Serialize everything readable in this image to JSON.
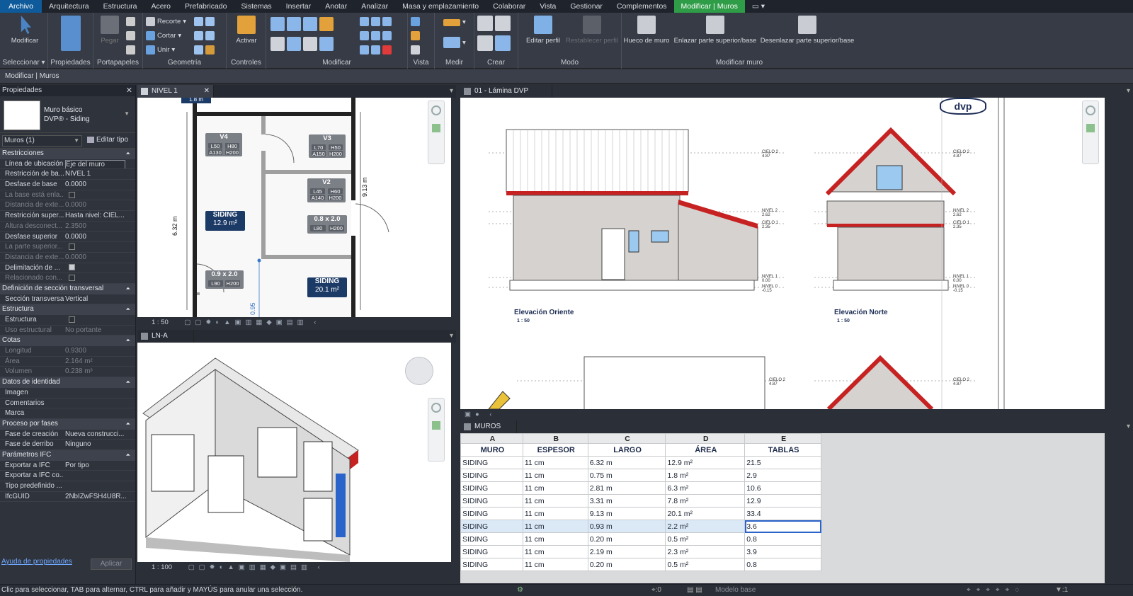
{
  "menu": {
    "items": [
      "Archivo",
      "Arquitectura",
      "Estructura",
      "Acero",
      "Prefabricado",
      "Sistemas",
      "Insertar",
      "Anotar",
      "Analizar",
      "Masa y emplazamiento",
      "Colaborar",
      "Vista",
      "Gestionar",
      "Complementos",
      "Modificar | Muros",
      "▭ ▾"
    ]
  },
  "ribbon": {
    "modify_label": "Modificar",
    "properties_label": "Propiedades",
    "paste_label": "Pegar",
    "cut_label": "Recorte",
    "cortar_label": "Cortar",
    "join_label": "Unir",
    "activate_label": "Activar",
    "edit_profile_label": "Editar perfil",
    "reset_profile_label": "Restablecer perfil",
    "wall_opening_label": "Hueco de muro",
    "attach_label": "Enlazar parte superior/base",
    "detach_label": "Desenlazar parte superior/base",
    "groups": [
      "Seleccionar ▾",
      "Propiedades",
      "Portapapeles",
      "Geometría",
      "Controles",
      "Modificar",
      "Vista",
      "Medir",
      "Crear",
      "Modo",
      "Modificar muro"
    ]
  },
  "context": {
    "title": "Modificar | Muros"
  },
  "properties": {
    "title": "Propiedades",
    "type_family": "Muro básico",
    "type_name": "DVP® - Siding",
    "selection": "Muros (1)",
    "edit_type": "Editar tipo",
    "sections": {
      "restricciones": "Restricciones",
      "seccion": "Definición de sección transversal",
      "estructura": "Estructura",
      "cotas": "Cotas",
      "identidad": "Datos de identidad",
      "fases": "Proceso por fases",
      "ifc": "Parámetros IFC"
    },
    "rows": {
      "r1k": "Línea de ubicación",
      "r1v": "Eje del muro",
      "r2k": "Restricción de ba...",
      "r2v": "NIVEL 1",
      "r3k": "Desfase de base",
      "r3v": "0.0000",
      "r4k": "La base está enla...",
      "r5k": "Distancia de exte...",
      "r5v": "0.0000",
      "r6k": "Restricción super...",
      "r6v": "Hasta nivel: CIEL...",
      "r7k": "Altura desconect...",
      "r7v": "2.3500",
      "r8k": "Desfase superior",
      "r8v": "0.0000",
      "r9k": "La parte superior...",
      "r10k": "Distancia de exte...",
      "r10v": "0.0000",
      "r11k": "Delimitación de ...",
      "r12k": "Relacionado con...",
      "s1k": "Sección transversal",
      "s1v": "Vertical",
      "e1k": "Estructura",
      "e2k": "Uso estructural",
      "e2v": "No portante",
      "c1k": "Longitud",
      "c1v": "0.9300",
      "c2k": "Área",
      "c2v": "2.164 m²",
      "c3k": "Volumen",
      "c3v": "0.238 m³",
      "i1k": "Imagen",
      "i2k": "Comentarios",
      "i3k": "Marca",
      "f1k": "Fase de creación",
      "f1v": "Nueva construcci...",
      "f2k": "Fase de derribo",
      "f2v": "Ninguno",
      "p1k": "Exportar a IFC",
      "p1v": "Por tipo",
      "p2k": "Exportar a IFC co...",
      "p3k": "Tipo predefinido ...",
      "p4k": "IfcGUID",
      "p4v": "2NbIZwFSH4U8R..."
    },
    "help": "Ayuda de propiedades",
    "apply": "Aplicar"
  },
  "plan": {
    "tab": "NIVEL 1",
    "scale": "1 : 50",
    "dim_top": "1.8 m",
    "dim_left": "6.32 m",
    "dim_right": "9.13 m",
    "dim_bottom": "0.95",
    "v4": "V4",
    "v4a": "L50",
    "v4b": "H80",
    "v4c": "A130",
    "v4d": "H200",
    "v3": "V3",
    "v3a": "L70",
    "v3b": "H50",
    "v3c": "A150",
    "v3d": "H200",
    "v2": "V2",
    "v2a": "L45",
    "v2b": "H60",
    "v2c": "A140",
    "v2d": "H200",
    "p1": "0.8 x 2.0",
    "p1a": "L80",
    "p1b": "H200",
    "p2": "0.9 x 2.0",
    "p2a": "L90",
    "p2b": "H200",
    "s1": "SIDING",
    "s1v": "12.9 m²",
    "s2": "SIDING",
    "s2v": "20.1 m²"
  },
  "iso": {
    "tab": "LN-A",
    "scale": "1 : 100"
  },
  "sheet": {
    "tab": "01 - Lámina DVP",
    "logo": "dvp",
    "elev1": "Elevación Oriente",
    "elev1s": "1 : 50",
    "elev2": "Elevación Norte",
    "elev2s": "1 : 50",
    "lv_cielo2": "CIELO 2",
    "lv_cielo2v": "4.87",
    "lv_nivel2": "NIVEL 2",
    "lv_nivel2v": "2.62",
    "lv_cielo1": "CIELO 1",
    "lv_cielo1v": "2.35",
    "lv_nivel1": "NIVEL 1",
    "lv_nivel1v": "0.00",
    "lv_nivel0": "NIVEL 0",
    "lv_nivel0v": "-0.15"
  },
  "schedule": {
    "tab": "MUROS",
    "letters": [
      "A",
      "B",
      "C",
      "D",
      "E"
    ],
    "headers": [
      "MURO",
      "ESPESOR",
      "LARGO",
      "ÁREA",
      "TABLAS"
    ],
    "rows": [
      [
        "SIDING",
        "11 cm",
        "6.32 m",
        "12.9 m²",
        "21.5"
      ],
      [
        "SIDING",
        "11 cm",
        "0.75 m",
        "1.8 m²",
        "2.9"
      ],
      [
        "SIDING",
        "11 cm",
        "2.81 m",
        "6.3 m²",
        "10.6"
      ],
      [
        "SIDING",
        "11 cm",
        "3.31 m",
        "7.8 m²",
        "12.9"
      ],
      [
        "SIDING",
        "11 cm",
        "9.13 m",
        "20.1 m²",
        "33.4"
      ],
      [
        "SIDING",
        "11 cm",
        "0.93 m",
        "2.2 m²",
        "3.6"
      ],
      [
        "SIDING",
        "11 cm",
        "0.20 m",
        "0.5 m²",
        "0.8"
      ],
      [
        "SIDING",
        "11 cm",
        "2.19 m",
        "2.3 m²",
        "3.9"
      ],
      [
        "SIDING",
        "11 cm",
        "0.20 m",
        "0.5 m²",
        "0.8"
      ]
    ],
    "selected_row": 5
  },
  "status": {
    "message": "Clic para seleccionar, TAB para alternar, CTRL para añadir y MAYÚS para anular una selección.",
    "zero": ":0",
    "model": "Modelo base",
    "filter": ":1"
  },
  "colors": {
    "accent": "#2f9d47",
    "file": "#0e5a9a",
    "tag": "#1c3a66",
    "roof": "#d21f1f"
  }
}
